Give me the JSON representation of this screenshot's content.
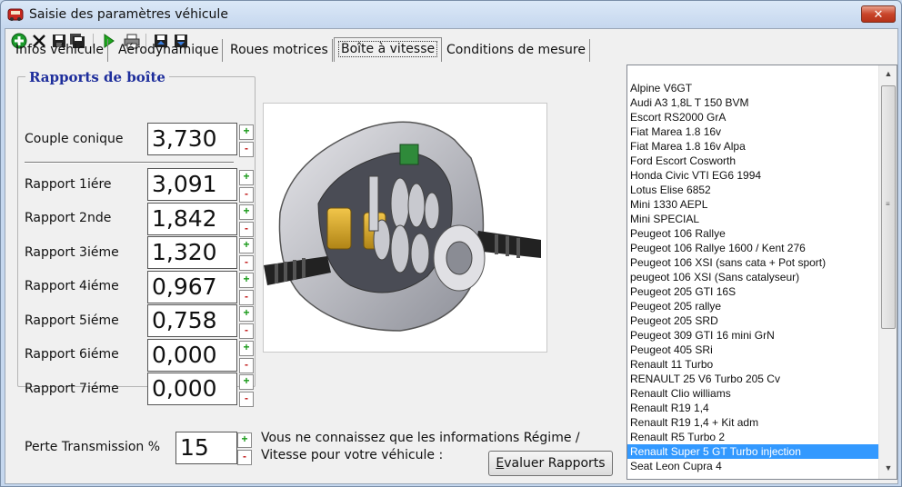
{
  "window": {
    "title": "Saisie des paramètres véhicule",
    "close_label": "✕"
  },
  "toolbar": {
    "buttons": [
      "add-icon",
      "delete-icon",
      "save-icon",
      "save-all-icon",
      "play-icon",
      "print-icon",
      "import-icon",
      "export-icon"
    ]
  },
  "tabs": [
    {
      "label": "Infos véhicule"
    },
    {
      "label": "Aérodynamique"
    },
    {
      "label": "Roues motrices"
    },
    {
      "label": "Boîte à vitesse",
      "active": true
    },
    {
      "label": "Conditions de mesure"
    }
  ],
  "gearbox": {
    "group_title": "Rapports de boîte",
    "couple_label": "Couple conique",
    "couple_value": "3,730",
    "ratios": [
      {
        "label": "Rapport 1iére",
        "value": "3,091"
      },
      {
        "label": "Rapport 2nde",
        "value": "1,842"
      },
      {
        "label": "Rapport 3iéme",
        "value": "1,320"
      },
      {
        "label": "Rapport 4iéme",
        "value": "0,967"
      },
      {
        "label": "Rapport 5iéme",
        "value": "0,758"
      },
      {
        "label": "Rapport 6iéme",
        "value": "0,000"
      },
      {
        "label": "Rapport 7iéme",
        "value": "0,000"
      }
    ],
    "spin_up": "+",
    "spin_down": "-"
  },
  "transmission": {
    "label": "Perte Transmission %",
    "value": "15"
  },
  "info": {
    "text": "Vous ne connaissez que les informations Régime / Vitesse pour votre véhicule :",
    "button_prefix": "E",
    "button_rest": "valuer Rapports"
  },
  "vehicles": {
    "items": [
      "Alpine V6GT",
      "Audi A3 1,8L T 150 BVM",
      "Escort RS2000 GrA",
      "Fiat Marea 1.8 16v",
      "Fiat Marea 1.8 16v Alpa",
      "Ford Escort Cosworth",
      "Honda Civic VTI EG6 1994",
      "Lotus Elise 6852",
      "Mini 1330 AEPL",
      "Mini SPECIAL",
      "Peugeot 106 Rallye",
      "Peugeot 106 Rallye 1600 / Kent 276",
      "Peugeot 106 XSI (sans cata + Pot sport)",
      "peugeot 106 XSI (Sans catalyseur)",
      "Peugeot 205 GTI 16S",
      "Peugeot 205 rallye",
      "Peugeot 205 SRD",
      "Peugeot 309 GTI 16 mini GrN",
      "Peugeot 405 SRi",
      "Renault 11 Turbo",
      "RENAULT 25 V6 Turbo 205 Cv",
      "Renault Clio williams",
      "Renault R19 1,4",
      "Renault R19 1,4 + Kit adm",
      "Renault R5 Turbo 2",
      "Renault Super 5 GT Turbo injection",
      "Seat Leon Cupra 4"
    ],
    "selected": "Renault Super 5 GT Turbo injection"
  }
}
